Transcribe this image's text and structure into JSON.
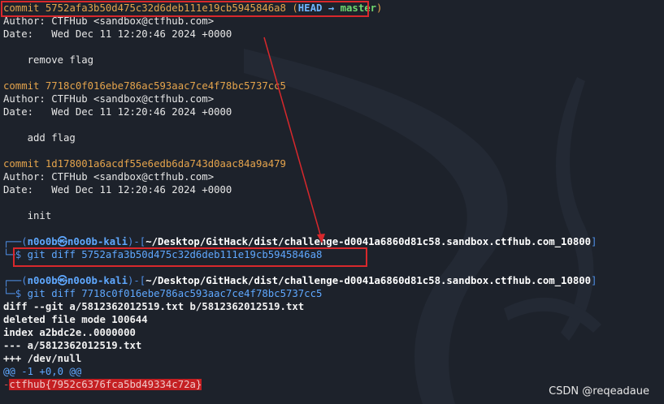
{
  "lines": {
    "c1_label": "commit",
    "c1_hash": "5752afa3b50d475c32d6deb111e19cb5945846a8",
    "c1_open": "(",
    "c1_head": "HEAD",
    "c1_arrow": "→",
    "c1_branch": "master",
    "c1_close": ")",
    "c1_author": "Author: CTFHub <sandbox@ctfhub.com>",
    "c1_date": "Date:   Wed Dec 11 12:20:46 2024 +0000",
    "c1_msg": "    remove flag",
    "c2_label": "commit",
    "c2_hash": "7718c0f016ebe786ac593aac7ce4f78bc5737cc5",
    "c2_author": "Author: CTFHub <sandbox@ctfhub.com>",
    "c2_date": "Date:   Wed Dec 11 12:20:46 2024 +0000",
    "c2_msg": "    add flag",
    "c3_label": "commit",
    "c3_hash": "1d178001a6acdf55e6edb6da743d0aac84a9a479",
    "c3_author": "Author: CTFHub <sandbox@ctfhub.com>",
    "c3_date": "Date:   Wed Dec 11 12:20:46 2024 +0000",
    "c3_msg": "    init"
  },
  "prompt1": {
    "corner": "┌──(",
    "user": "n0o0b㉿n0o0b-kali",
    "mid": ")-[",
    "path": "~/Desktop/GitHack/dist/challenge-d0041a6860d81c58.sandbox.ctfhub.com_10800",
    "end": "]",
    "arrow": "└─$",
    "command": "git diff 5752afa3b50d475c32d6deb111e19cb5945846a8"
  },
  "prompt2": {
    "corner": "┌──(",
    "user": "n0o0b㉿n0o0b-kali",
    "mid": ")-[",
    "path": "~/Desktop/GitHack/dist/challenge-d0041a6860d81c58.sandbox.ctfhub.com_10800",
    "end": "]",
    "arrow": "└─$",
    "command": "git diff 7718c0f016ebe786ac593aac7ce4f78bc5737cc5"
  },
  "diff": {
    "header": "diff --git a/5812362012519.txt b/5812362012519.txt",
    "mode": "deleted file mode 100644",
    "index": "index a2bdc2e..0000000",
    "minus_file": "--- a/5812362012519.txt",
    "plus_file": "+++ /dev/null",
    "hunk": "@@ -1 +0,0 @@",
    "removed_prefix": "-",
    "removed_line": "ctfhub{7952c6376fca5bd49334c72a}"
  },
  "watermark": "CSDN @reqeadaue",
  "colors": {
    "background": "#1d222b",
    "commit_orange": "#e5a44c",
    "head_blue": "#6fb6ff",
    "branch_green": "#6fd86f",
    "annotation_red": "#d8282c"
  }
}
